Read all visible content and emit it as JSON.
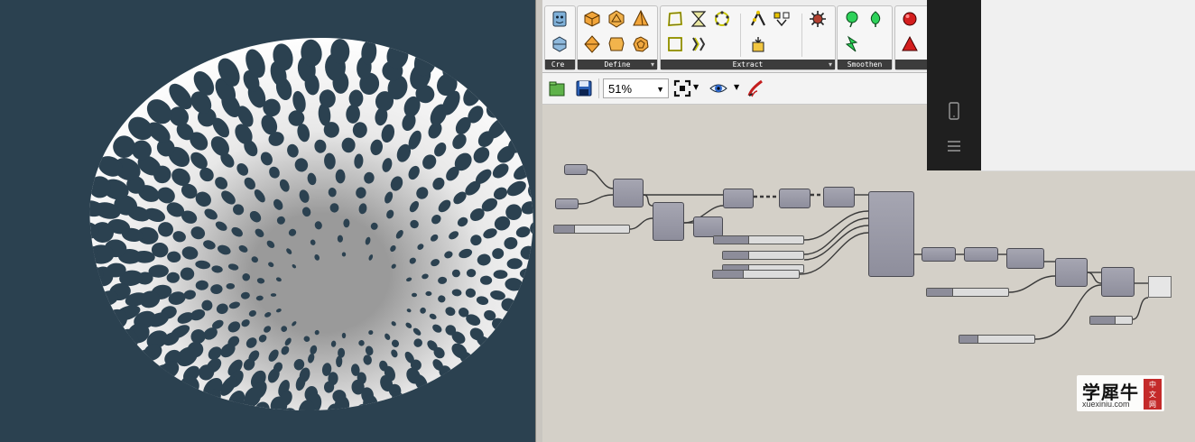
{
  "ribbon": {
    "panels": [
      {
        "label": "Cre ···"
      },
      {
        "label": "Define"
      },
      {
        "label": "Extract"
      },
      {
        "label": "Smoothen"
      }
    ]
  },
  "toolbar": {
    "zoom": "51%",
    "icons": [
      "open-file-icon",
      "save-icon",
      "zoom-extents-icon",
      "preview-eye-icon",
      "sketch-brush-icon"
    ]
  },
  "overlay": {
    "icons": [
      "phone-icon",
      "menu-icon"
    ]
  },
  "watermark": {
    "cn": "学犀牛",
    "en": "xuexiniu.com",
    "tag1": "中",
    "tag2": "文",
    "tag3": "网"
  },
  "colors": {
    "viewport_bg": "#2b4150",
    "canvas_bg": "#d4d0c8",
    "component": "#9696a4",
    "mesh": "#f2f2f2"
  }
}
